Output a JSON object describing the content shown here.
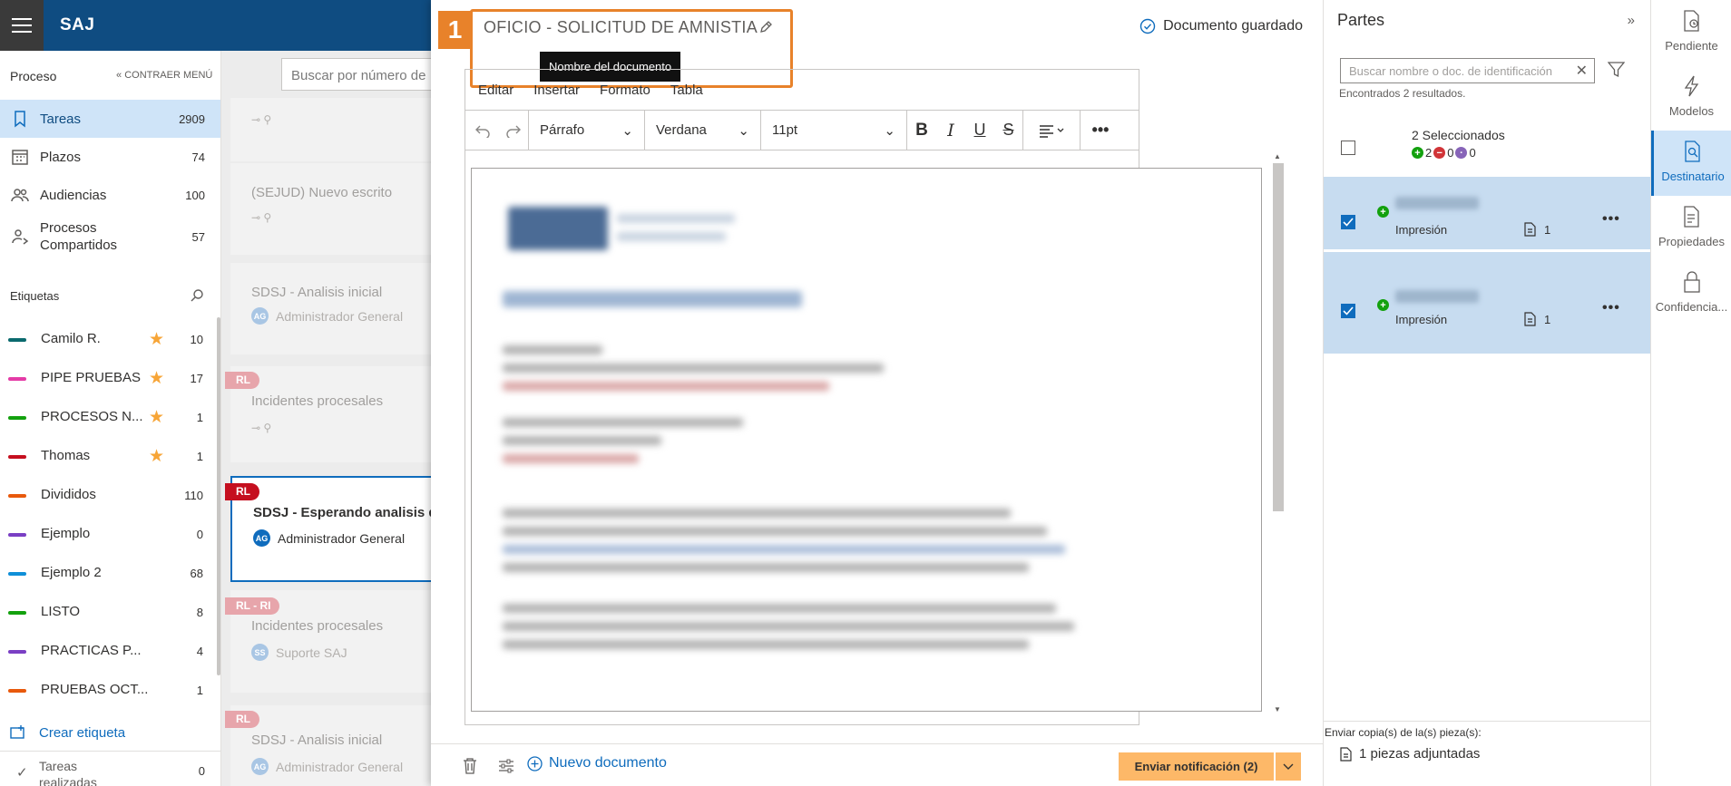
{
  "app": {
    "title": "SAJ"
  },
  "sidebar": {
    "section_title": "Proceso",
    "collapse_label": "CONTRAER MENÚ",
    "nav": [
      {
        "label": "Tareas",
        "count": "2909",
        "active": true,
        "icon": "tasks-icon"
      },
      {
        "label": "Plazos",
        "count": "74",
        "active": false,
        "icon": "calendar-icon"
      },
      {
        "label": "Audiencias",
        "count": "100",
        "active": false,
        "icon": "people-icon"
      },
      {
        "label": "Procesos Compartidos",
        "count": "57",
        "active": false,
        "icon": "shared-icon"
      }
    ],
    "tags_title": "Etiquetas",
    "tags": [
      {
        "name": "Camilo R.",
        "count": "10",
        "color": "#0b6a6e",
        "starred": true
      },
      {
        "name": "PIPE PRUEBAS",
        "count": "17",
        "color": "#e43ba6",
        "starred": true
      },
      {
        "name": "PROCESOS N...",
        "count": "1",
        "color": "#13a10e",
        "starred": true
      },
      {
        "name": "Thomas",
        "count": "1",
        "color": "#c50f1f",
        "starred": true
      },
      {
        "name": "Divididos",
        "count": "110",
        "color": "#e8590c",
        "starred": false
      },
      {
        "name": "Ejemplo",
        "count": "0",
        "color": "#7a3fc4",
        "starred": false
      },
      {
        "name": "Ejemplo 2",
        "count": "68",
        "color": "#0f8fd8",
        "starred": false
      },
      {
        "name": "LISTO",
        "count": "8",
        "color": "#13a10e",
        "starred": false
      },
      {
        "name": "PRACTICAS P...",
        "count": "4",
        "color": "#7a3fc4",
        "starred": false
      },
      {
        "name": "PRUEBAS OCT...",
        "count": "1",
        "color": "#e8590c",
        "starred": false
      }
    ],
    "create_tag": "Crear etiqueta",
    "done_label": "Tareas realizadas",
    "done_count": "0"
  },
  "tasklist": {
    "search_placeholder": "Buscar por número de",
    "cards": [
      {
        "title": "",
        "author": "",
        "badge": "",
        "selected": false
      },
      {
        "title": "(SEJUD) Nuevo escrito",
        "author": "",
        "badge": "",
        "selected": false
      },
      {
        "title": "SDSJ - Analisis inicial",
        "author": "Administrador General",
        "initials": "AG",
        "badge": "",
        "selected": false
      },
      {
        "title": "Incidentes procesales",
        "author": "",
        "badge": "RL",
        "selected": false
      },
      {
        "title": "SDSJ - Esperando analisis d",
        "author": "Administrador General",
        "initials": "AG",
        "badge": "RL",
        "selected": true
      },
      {
        "title": "Incidentes procesales",
        "author": "Suporte SAJ",
        "initials": "SS",
        "badge": "RL - RI",
        "selected": false
      },
      {
        "title": "SDSJ - Analisis inicial",
        "author": "Administrador General",
        "initials": "AG",
        "badge": "RL",
        "selected": false
      }
    ]
  },
  "editor": {
    "step": "1",
    "doc_title": "OFICIO - SOLICITUD DE AMNISTIA",
    "tooltip": "Nombre del documento",
    "saved_status": "Documento guardado",
    "menu": [
      "Editar",
      "Insertar",
      "Formato",
      "Tabla"
    ],
    "block_format": "Párrafo",
    "font": "Verdana",
    "font_size": "11pt",
    "new_document": "Nuevo documento",
    "send_button": "Enviar notificación (2)"
  },
  "partes": {
    "title": "Partes",
    "search_placeholder": "Buscar nombre o doc. de identificación",
    "found_text": "Encontrados 2 resultados.",
    "selected_label": "2 Seleccionados",
    "counts": {
      "add": "2",
      "remove": "0",
      "other": "0"
    },
    "parties": [
      {
        "type": "Impresión",
        "docs": "1",
        "checked": true
      },
      {
        "type": "Impresión",
        "docs": "1",
        "checked": true
      }
    ],
    "copies_label": "Enviar copia(s) de la(s) pieza(s):",
    "attachments": "1 piezas adjuntadas"
  },
  "rail": [
    {
      "label": "Pendiente",
      "active": false,
      "icon": "pending-doc-icon"
    },
    {
      "label": "Modelos",
      "active": false,
      "icon": "lightning-icon"
    },
    {
      "label": "Destinatario",
      "active": true,
      "icon": "recipient-search-icon"
    },
    {
      "label": "Propiedades",
      "active": false,
      "icon": "properties-doc-icon"
    },
    {
      "label": "Confidencia...",
      "active": false,
      "icon": "lock-icon"
    }
  ],
  "colors": {
    "brand": "#0f4c81",
    "accent": "#0f6cbd",
    "highlight": "#e8822a",
    "send": "#fdb868"
  }
}
